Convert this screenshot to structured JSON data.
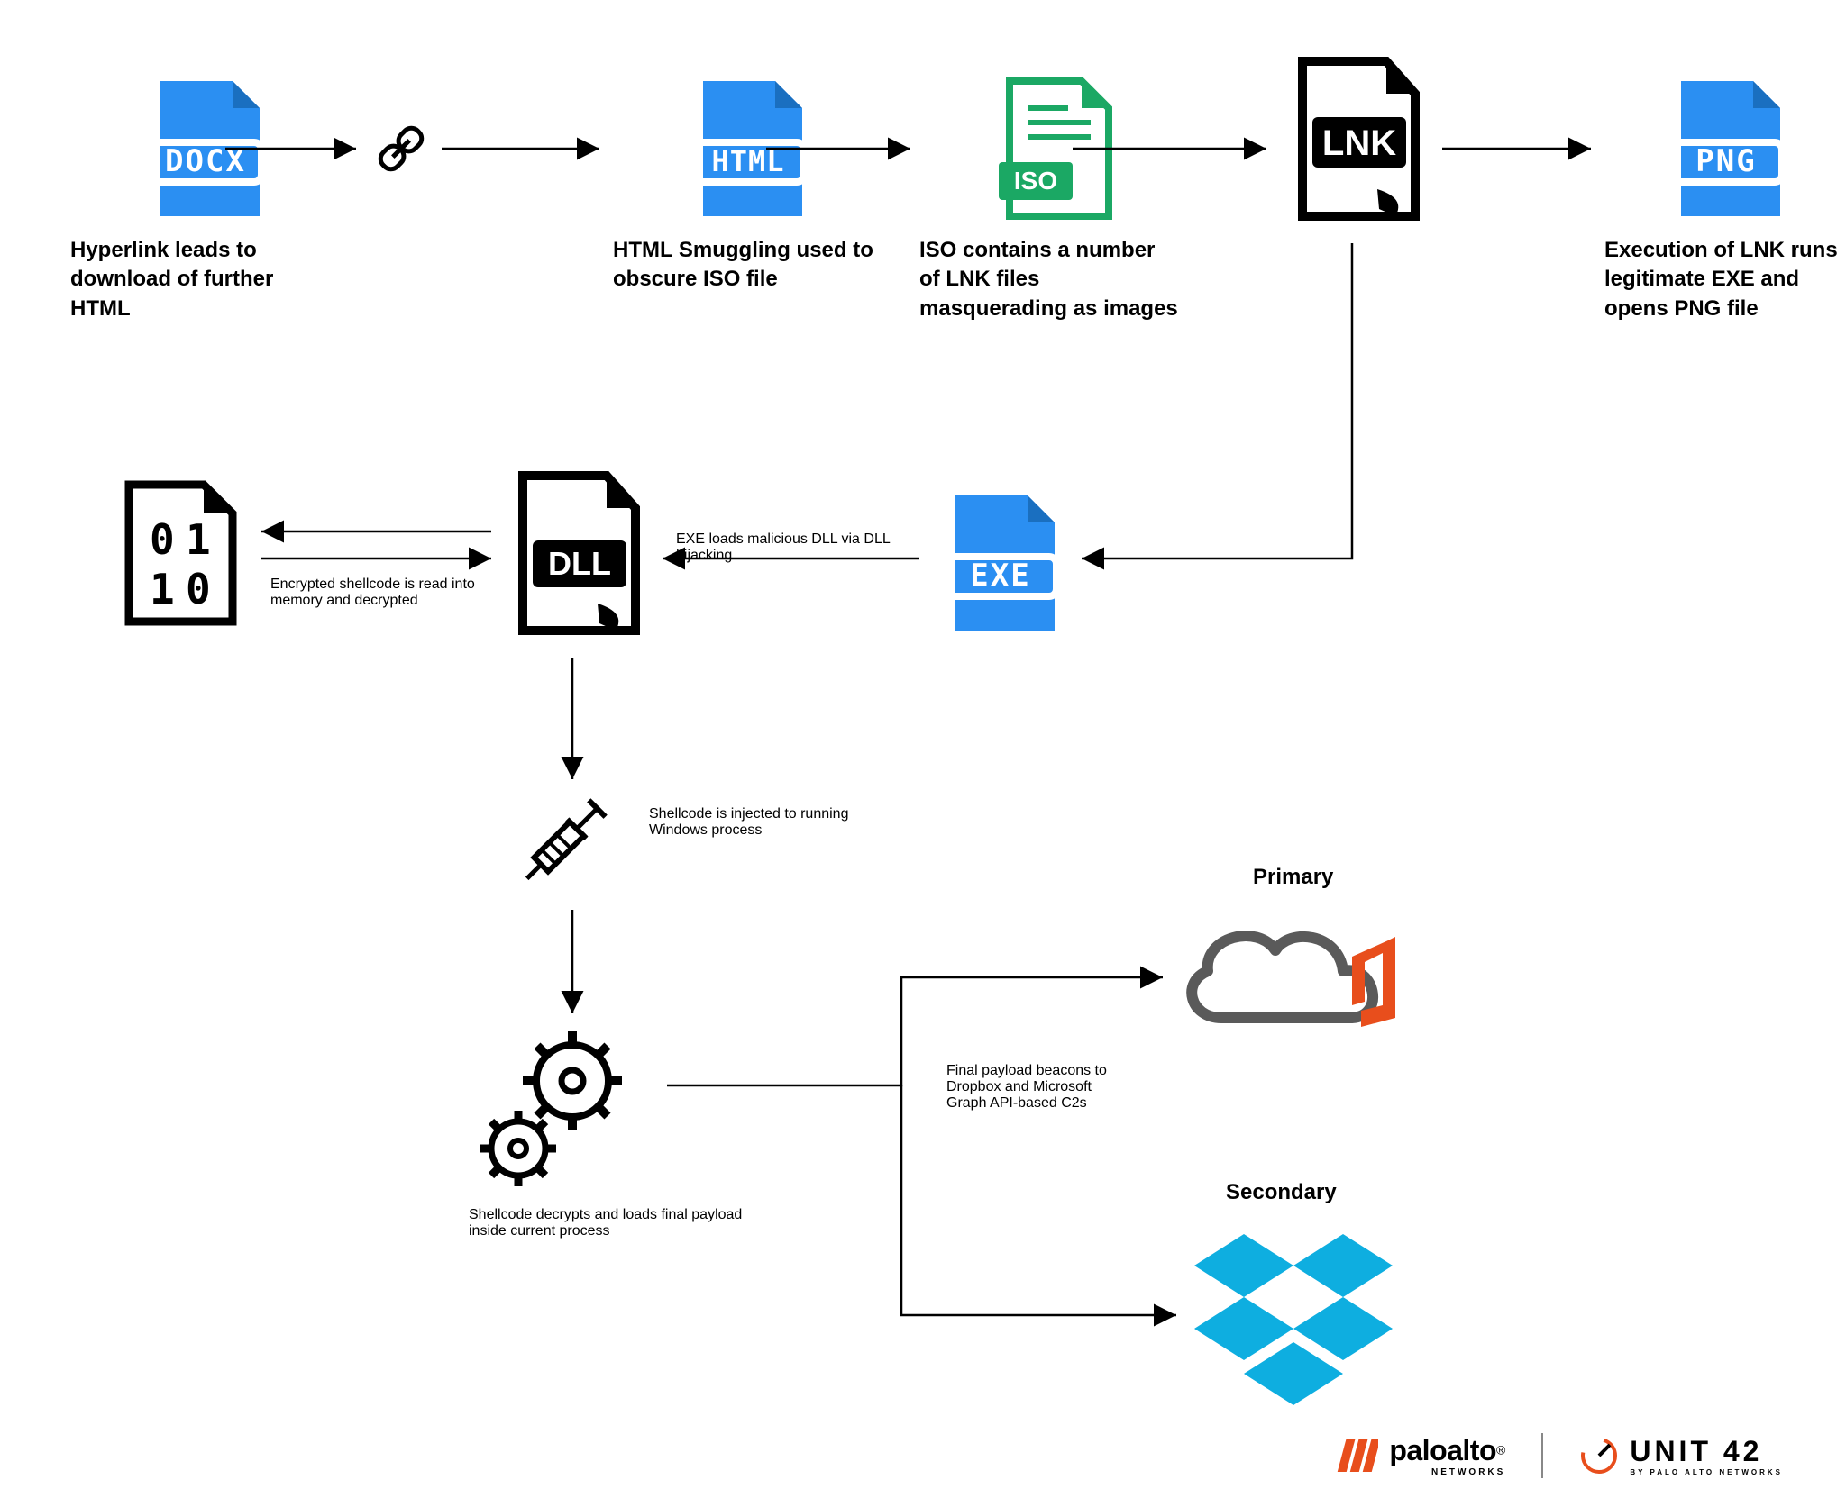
{
  "nodes": {
    "docx": {
      "badge": "DOCX",
      "caption": "Hyperlink leads to download of further HTML"
    },
    "html": {
      "badge": "HTML",
      "caption": "HTML Smuggling used to obscure ISO file"
    },
    "iso": {
      "badge": "ISO",
      "caption": "ISO contains a number of LNK files masquerading as images"
    },
    "lnk": {
      "badge": "LNK",
      "caption": ""
    },
    "png": {
      "badge": "PNG",
      "caption": "Execution of LNK runs legitimate EXE and opens PNG file"
    },
    "exe": {
      "badge": "EXE",
      "caption": "EXE loads malicious DLL via DLL hijacking"
    },
    "dll": {
      "badge": "DLL",
      "caption": ""
    },
    "binary": {
      "caption": "Encrypted shellcode is read into memory and decrypted"
    },
    "syringe": {
      "caption": "Shellcode is injected to running Windows process"
    },
    "gears": {
      "caption": "Shellcode decrypts and loads final payload inside current process"
    },
    "c2": {
      "caption": "Final payload beacons to Dropbox and Microsoft Graph API-based C2s"
    },
    "primary_label": "Primary",
    "secondary_label": "Secondary"
  },
  "footer": {
    "paloalto": "paloalto",
    "paloalto_sub": "NETWORKS",
    "unit42": "UNIT 42",
    "unit42_sub": "BY PALO ALTO NETWORKS"
  },
  "colors": {
    "blue": "#2B8FF2",
    "green": "#1BA864",
    "black": "#000000",
    "dropbox": "#0EAEE0",
    "orange": "#E84E1C",
    "grey": "#5A5A5A"
  }
}
